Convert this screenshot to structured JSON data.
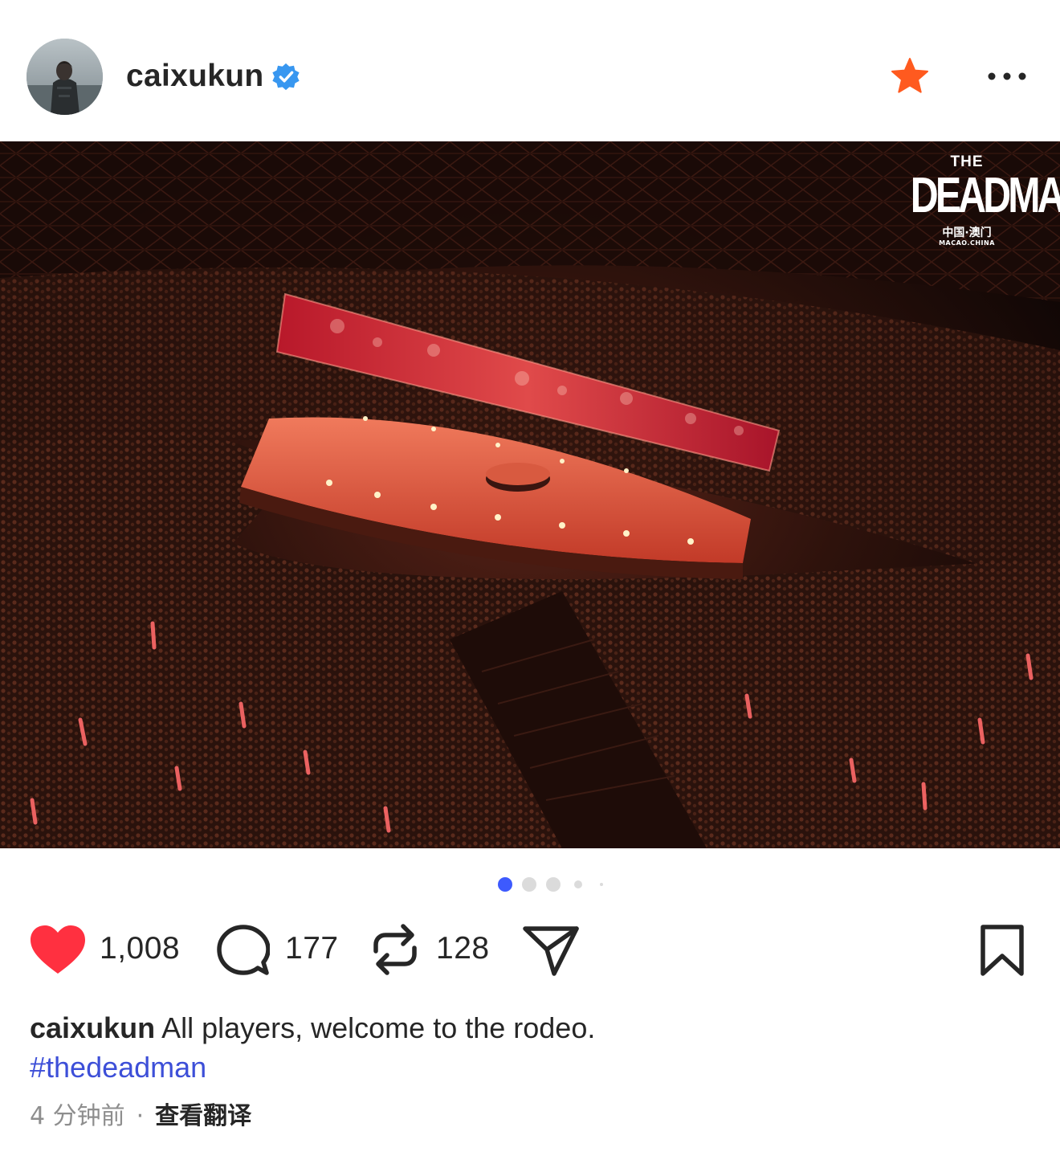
{
  "header": {
    "username": "caixukun",
    "verified_icon": "verified-badge-icon",
    "star_icon": "favorite-star-icon",
    "more_icon": "more-options-icon",
    "colors": {
      "verified": "#3897f0",
      "star": "#ff5a1f"
    }
  },
  "post_image": {
    "logo_the": "THE",
    "logo_title": "DEADMAN",
    "logo_location_cn": "中国·澳门",
    "logo_location_en": "MACAO.CHINA",
    "slide_index": 1,
    "slide_count": 5
  },
  "actions": {
    "like_count": "1,008",
    "comment_count": "177",
    "repost_count": "128",
    "icons": [
      "heart-icon",
      "comment-icon",
      "repost-icon",
      "share-icon",
      "bookmark-icon"
    ],
    "colors": {
      "like": "#ff3040"
    }
  },
  "caption": {
    "username": "caixukun",
    "text": " All players, welcome to the rodeo.",
    "hashtag": "#thedeadman"
  },
  "meta": {
    "time": "4 分钟前",
    "separator": "·",
    "translate": "查看翻译"
  }
}
